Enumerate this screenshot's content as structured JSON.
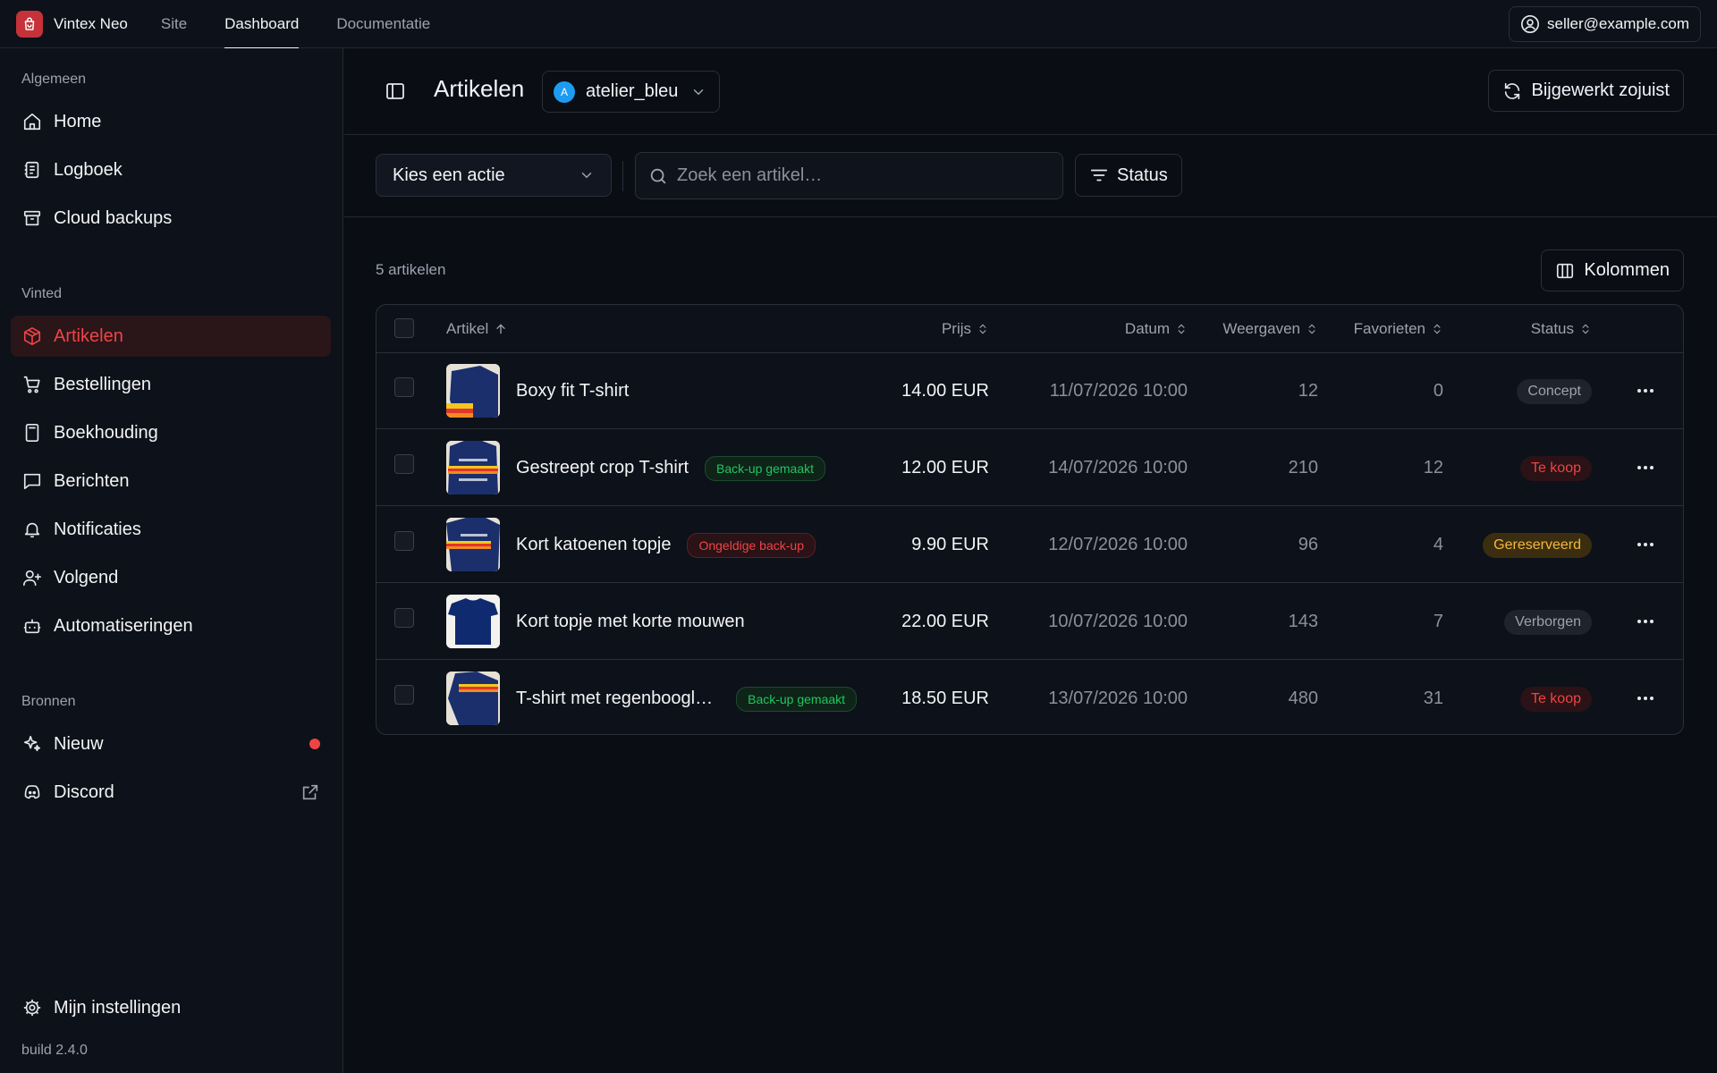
{
  "app": {
    "name": "Vintex Neo"
  },
  "topnav": [
    {
      "label": "Site"
    },
    {
      "label": "Dashboard"
    },
    {
      "label": "Documentatie"
    }
  ],
  "user": {
    "email": "seller@example.com"
  },
  "sidebar": {
    "section_general": "Algemeen",
    "general": [
      {
        "label": "Home",
        "icon": "home-icon"
      },
      {
        "label": "Logboek",
        "icon": "logbook-icon"
      },
      {
        "label": "Cloud backups",
        "icon": "archive-icon"
      }
    ],
    "section_vinted": "Vinted",
    "vinted": [
      {
        "label": "Artikelen",
        "icon": "package-icon"
      },
      {
        "label": "Bestellingen",
        "icon": "cart-icon"
      },
      {
        "label": "Boekhouding",
        "icon": "calculator-icon"
      },
      {
        "label": "Berichten",
        "icon": "message-icon"
      },
      {
        "label": "Notificaties",
        "icon": "bell-icon"
      },
      {
        "label": "Volgend",
        "icon": "user-plus-icon"
      },
      {
        "label": "Automatiseringen",
        "icon": "bot-icon"
      }
    ],
    "section_sources": "Bronnen",
    "sources": [
      {
        "label": "Nieuw",
        "icon": "sparkles-icon"
      },
      {
        "label": "Discord",
        "icon": "discord-icon"
      }
    ],
    "settings": "Mijn instellingen",
    "build": "build 2.4.0"
  },
  "header": {
    "title": "Artikelen",
    "account": {
      "initial": "A",
      "name": "atelier_bleu"
    },
    "refresh_label": "Bijgewerkt zojuist"
  },
  "toolbar": {
    "action_label": "Kies een actie",
    "search_placeholder": "Zoek een artikel…",
    "search_value": "",
    "status_label": "Status"
  },
  "list": {
    "count_label": "5 artikelen",
    "columns_label": "Kolommen"
  },
  "table": {
    "headers": {
      "item": "Artikel",
      "price": "Prijs",
      "date": "Datum",
      "views": "Weergaven",
      "favorites": "Favorieten",
      "status": "Status"
    },
    "rows": [
      {
        "name": "Boxy fit T-shirt",
        "badge": "",
        "badge_type": "",
        "price": "14.00 EUR",
        "date": "11/07/2026 10:00",
        "views": "12",
        "favorites": "0",
        "status": "Concept",
        "status_type": "concept"
      },
      {
        "name": "Gestreept crop T-shirt",
        "badge": "Back-up gemaakt",
        "badge_type": "ok",
        "price": "12.00 EUR",
        "date": "14/07/2026 10:00",
        "views": "210",
        "favorites": "12",
        "status": "Te koop",
        "status_type": "sale"
      },
      {
        "name": "Kort katoenen topje",
        "badge": "Ongeldige back-up",
        "badge_type": "bad",
        "price": "9.90 EUR",
        "date": "12/07/2026 10:00",
        "views": "96",
        "favorites": "4",
        "status": "Gereserveerd",
        "status_type": "reserved"
      },
      {
        "name": "Kort topje met korte mouwen",
        "badge": "",
        "badge_type": "",
        "price": "22.00 EUR",
        "date": "10/07/2026 10:00",
        "views": "143",
        "favorites": "7",
        "status": "Verborgen",
        "status_type": "hidden"
      },
      {
        "name": "T-shirt met regenboogl…",
        "badge": "Back-up gemaakt",
        "badge_type": "ok",
        "price": "18.50 EUR",
        "date": "13/07/2026 10:00",
        "views": "480",
        "favorites": "31",
        "status": "Te koop",
        "status_type": "sale"
      }
    ]
  },
  "colors": {
    "accent": "#ef4444",
    "background": "#0a0d14",
    "panel": "#0d1119",
    "border": "#2a2f38"
  }
}
